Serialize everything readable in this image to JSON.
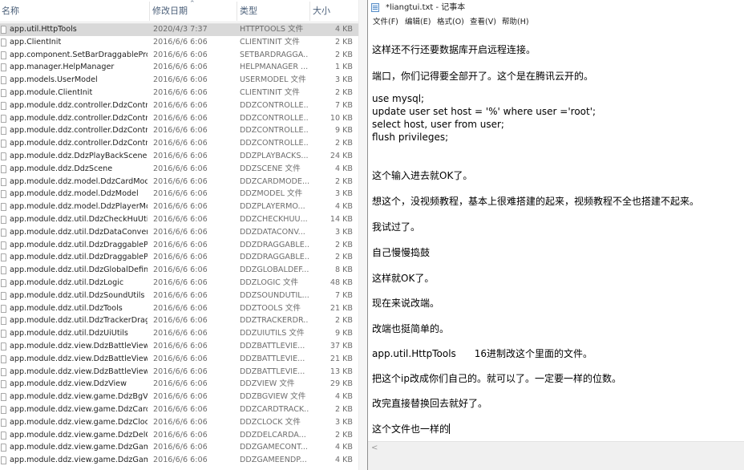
{
  "explorer": {
    "columns": {
      "name": "名称",
      "date": "修改日期",
      "type": "类型",
      "size": "大小"
    },
    "sort_icon": "chevron-up-icon",
    "files": [
      {
        "name": "app.util.HttpTools",
        "date": "2020/4/3 7:37",
        "type": "HTTPTOOLS 文件",
        "size": "4 KB",
        "selected": true
      },
      {
        "name": "app.ClientInit",
        "date": "2016/6/6 6:06",
        "type": "CLIENTINIT 文件",
        "size": "2 KB"
      },
      {
        "name": "app.component.SetBarDraggablePro...",
        "date": "2016/6/6 6:06",
        "type": "SETBARDRAGGA...",
        "size": "2 KB"
      },
      {
        "name": "app.manager.HelpManager",
        "date": "2016/6/6 6:06",
        "type": "HELPMANAGER ...",
        "size": "1 KB"
      },
      {
        "name": "app.models.UserModel",
        "date": "2016/6/6 6:06",
        "type": "USERMODEL 文件",
        "size": "3 KB"
      },
      {
        "name": "app.module.ClientInit",
        "date": "2016/6/6 6:06",
        "type": "CLIENTINIT 文件",
        "size": "2 KB"
      },
      {
        "name": "app.module.ddz.controller.DdzContr...",
        "date": "2016/6/6 6:06",
        "type": "DDZCONTROLLE...",
        "size": "7 KB"
      },
      {
        "name": "app.module.ddz.controller.DdzContr...",
        "date": "2016/6/6 6:06",
        "type": "DDZCONTROLLE...",
        "size": "10 KB"
      },
      {
        "name": "app.module.ddz.controller.DdzContr...",
        "date": "2016/6/6 6:06",
        "type": "DDZCONTROLLE...",
        "size": "9 KB"
      },
      {
        "name": "app.module.ddz.controller.DdzContr...",
        "date": "2016/6/6 6:06",
        "type": "DDZCONTROLLE...",
        "size": "2 KB"
      },
      {
        "name": "app.module.ddz.DdzPlayBackScene",
        "date": "2016/6/6 6:06",
        "type": "DDZPLAYBACKS...",
        "size": "24 KB"
      },
      {
        "name": "app.module.ddz.DdzScene",
        "date": "2016/6/6 6:06",
        "type": "DDZSCENE 文件",
        "size": "4 KB"
      },
      {
        "name": "app.module.ddz.model.DdzCardMod...",
        "date": "2016/6/6 6:06",
        "type": "DDZCARDMODE...",
        "size": "2 KB"
      },
      {
        "name": "app.module.ddz.model.DdzModel",
        "date": "2016/6/6 6:06",
        "type": "DDZMODEL 文件",
        "size": "3 KB"
      },
      {
        "name": "app.module.ddz.model.DdzPlayerMo...",
        "date": "2016/6/6 6:06",
        "type": "DDZPLAYERMO...",
        "size": "4 KB"
      },
      {
        "name": "app.module.ddz.util.DdzCheckHuUtils",
        "date": "2016/6/6 6:06",
        "type": "DDZCHECKHUU...",
        "size": "14 KB"
      },
      {
        "name": "app.module.ddz.util.DdzDataConvert",
        "date": "2016/6/6 6:06",
        "type": "DDZDATACONV...",
        "size": "3 KB"
      },
      {
        "name": "app.module.ddz.util.DdzDraggablePr...",
        "date": "2016/6/6 6:06",
        "type": "DDZDRAGGABLE...",
        "size": "2 KB"
      },
      {
        "name": "app.module.ddz.util.DdzDraggablePr...",
        "date": "2016/6/6 6:06",
        "type": "DDZDRAGGABLE...",
        "size": "2 KB"
      },
      {
        "name": "app.module.ddz.util.DdzGlobalDefine",
        "date": "2016/6/6 6:06",
        "type": "DDZGLOBALDEF...",
        "size": "8 KB"
      },
      {
        "name": "app.module.ddz.util.DdzLogic",
        "date": "2016/6/6 6:06",
        "type": "DDZLOGIC 文件",
        "size": "48 KB"
      },
      {
        "name": "app.module.ddz.util.DdzSoundUtils",
        "date": "2016/6/6 6:06",
        "type": "DDZSOUNDUTIL...",
        "size": "7 KB"
      },
      {
        "name": "app.module.ddz.util.DdzTools",
        "date": "2016/6/6 6:06",
        "type": "DDZTOOLS 文件",
        "size": "21 KB"
      },
      {
        "name": "app.module.ddz.util.DdzTrackerDrag...",
        "date": "2016/6/6 6:06",
        "type": "DDZTRACKERDR...",
        "size": "2 KB"
      },
      {
        "name": "app.module.ddz.util.DdzUiUtils",
        "date": "2016/6/6 6:06",
        "type": "DDZUIUTILS 文件",
        "size": "9 KB"
      },
      {
        "name": "app.module.ddz.view.DdzBattleView",
        "date": "2016/6/6 6:06",
        "type": "DDZBATTLEVIE...",
        "size": "37 KB"
      },
      {
        "name": "app.module.ddz.view.DdzBattleView_...",
        "date": "2016/6/6 6:06",
        "type": "DDZBATTLEVIE...",
        "size": "21 KB"
      },
      {
        "name": "app.module.ddz.view.DdzBattleView_...",
        "date": "2016/6/6 6:06",
        "type": "DDZBATTLEVIE...",
        "size": "13 KB"
      },
      {
        "name": "app.module.ddz.view.DdzView",
        "date": "2016/6/6 6:06",
        "type": "DDZVIEW 文件",
        "size": "29 KB"
      },
      {
        "name": "app.module.ddz.view.game.DdzBgVi...",
        "date": "2016/6/6 6:06",
        "type": "DDZBGVIEW 文件",
        "size": "4 KB"
      },
      {
        "name": "app.module.ddz.view.game.DdzCard...",
        "date": "2016/6/6 6:06",
        "type": "DDZCARDTRACK...",
        "size": "2 KB"
      },
      {
        "name": "app.module.ddz.view.game.DdzClock",
        "date": "2016/6/6 6:06",
        "type": "DDZCLOCK 文件",
        "size": "3 KB"
      },
      {
        "name": "app.module.ddz.view.game.DdzDelC...",
        "date": "2016/6/6 6:06",
        "type": "DDZDELCARDA...",
        "size": "2 KB"
      },
      {
        "name": "app.module.ddz.view.game.DdzGam...",
        "date": "2016/6/6 6:06",
        "type": "DDZGAMECONT...",
        "size": "4 KB"
      },
      {
        "name": "app.module.ddz.view.game.DdzGam...",
        "date": "2016/6/6 6:06",
        "type": "DDZGAMEENDP...",
        "size": "4 KB"
      }
    ]
  },
  "notepad": {
    "title": "*liangtui.txt - 记事本",
    "menu": [
      "文件(F)",
      "编辑(E)",
      "格式(O)",
      "查看(V)",
      "帮助(H)"
    ],
    "lines": [
      "这样还不行还要数据库开启远程连接。",
      "端口，你们记得要全部开了。这个是在腾讯云开的。",
      "use mysql;",
      "update user set host = '%' where user ='root';",
      "select host, user from user;",
      "flush privileges;",
      "这个输入进去就OK了。",
      "想这个，没视频教程，基本上很难搭建的起来，视频教程不全也搭建不起来。",
      "我试过了。",
      "自己慢慢捣鼓",
      "这样就OK了。",
      "现在来说改端。",
      "改端也挺简单的。",
      "app.util.HttpTools      16进制改这个里面的文件。",
      "把这个ip改成你们自己的。就可以了。一定要一样的位数。",
      "改完直接替换回去就好了。",
      "这个文件也一样的"
    ],
    "scroll_left_icon": "chevron-left-icon"
  }
}
